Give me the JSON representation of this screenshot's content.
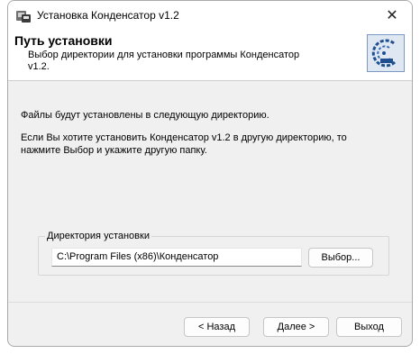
{
  "window": {
    "title": "Установка Конденсатор v1.2",
    "close_symbol": "✕"
  },
  "header": {
    "title": "Путь установки",
    "description_line1": "Выбор директории для установки программы Конденсатор",
    "description_line2": "v1.2.",
    "logo_icon": "installer-disk-icon"
  },
  "body": {
    "info1": "Файлы будут установлены в следующую директорию.",
    "info2_line1": "Если Вы хотите установить Конденсатор v1.2 в другую директорию, то",
    "info2_line2": "нажмите Выбор и укажите другую папку."
  },
  "directory": {
    "legend": "Директория установки",
    "path": "C:\\Program Files (x86)\\Конденсатор",
    "browse_label": "Выбор..."
  },
  "footer": {
    "back_label": "< Назад",
    "next_label": "Далее >",
    "exit_label": "Выход"
  },
  "colors": {
    "dialog_bg": "#f0f0f0",
    "header_bg": "#ffffff",
    "logo_accent": "#1f4f8f"
  }
}
